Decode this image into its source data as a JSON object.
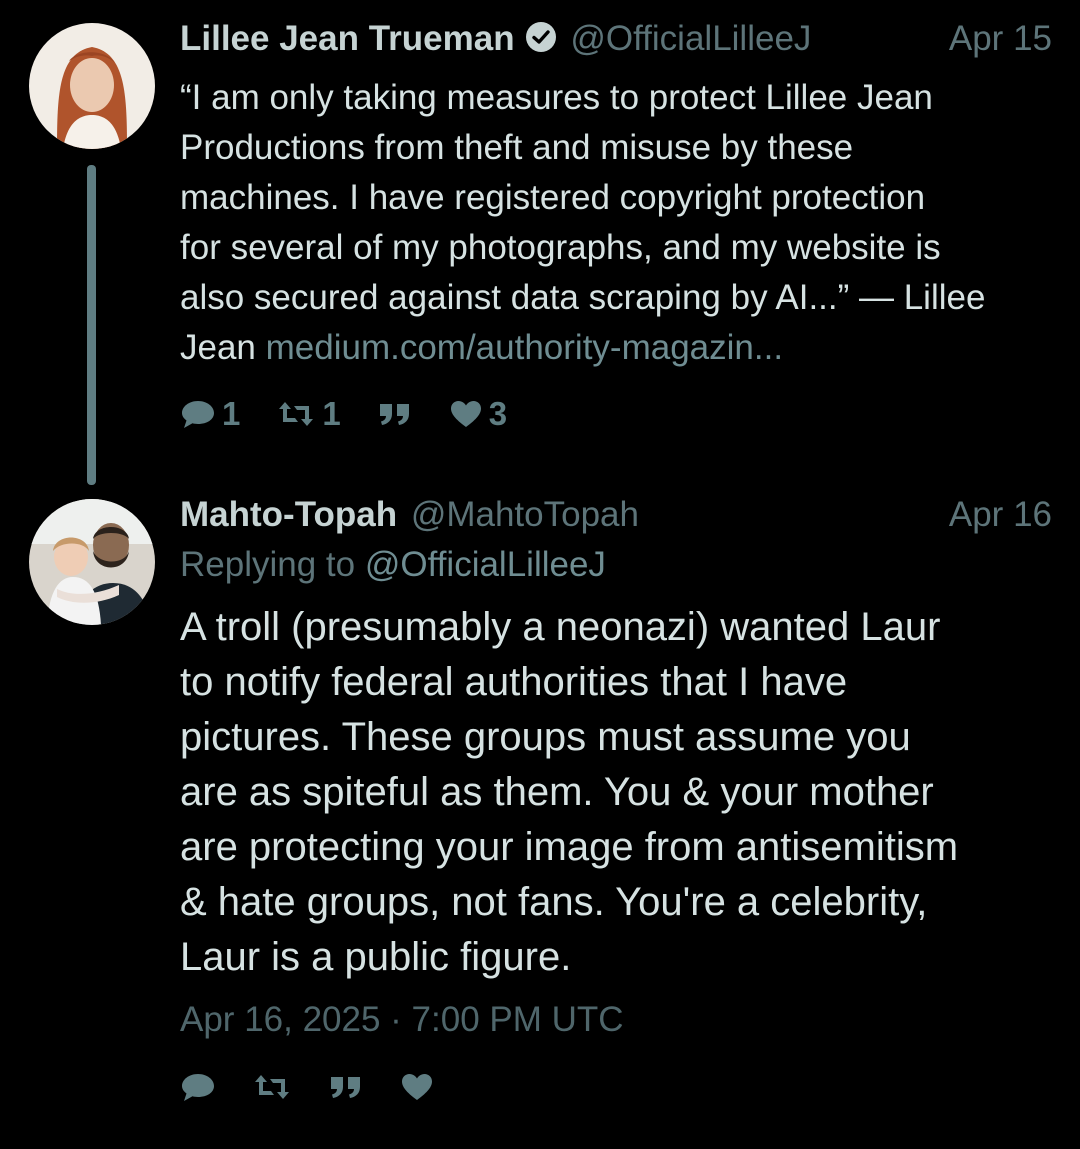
{
  "thread": [
    {
      "author": {
        "name": "Lillee Jean Trueman",
        "handle": "@OfficialLilleeJ",
        "verified": true
      },
      "date": "Apr 15",
      "text": "“I am only taking measures to protect Lillee Jean\nProductions from theft and misuse by these\nmachines. I have registered copyright protection\nfor several of my photographs, and my website is\nalso secured against data scraping by AI...” — Lillee\nJean ",
      "link": "medium.com/authority-magazin...",
      "counts": {
        "replies": "1",
        "retweets": "1",
        "likes": "3"
      }
    },
    {
      "author": {
        "name": "Mahto-Topah",
        "handle": "@MahtoTopah"
      },
      "date": "Apr 16",
      "replying_to_prefix": "Replying to",
      "replying_to_handle": "@OfficialLilleeJ",
      "text": "A troll (presumably a neonazi) wanted Laur\nto notify federal authorities that I have\npictures. These groups must assume you\nare as spiteful as them. You & your mother\nare protecting your image from antisemitism\n& hate groups, not fans. You're a celebrity,\nLaur is a public figure.",
      "timestamp": "Apr 16, 2025 · 7:00 PM UTC"
    }
  ],
  "icons": {
    "reply": "comment-bubble-icon",
    "retweet": "retweet-icon",
    "quote": "quote-icon",
    "like": "heart-icon",
    "verified": "verified-check-icon"
  },
  "colors": {
    "background": "#000000",
    "text": "#d6e2e2",
    "muted": "#5d7479",
    "accent": "#5f7d82"
  }
}
